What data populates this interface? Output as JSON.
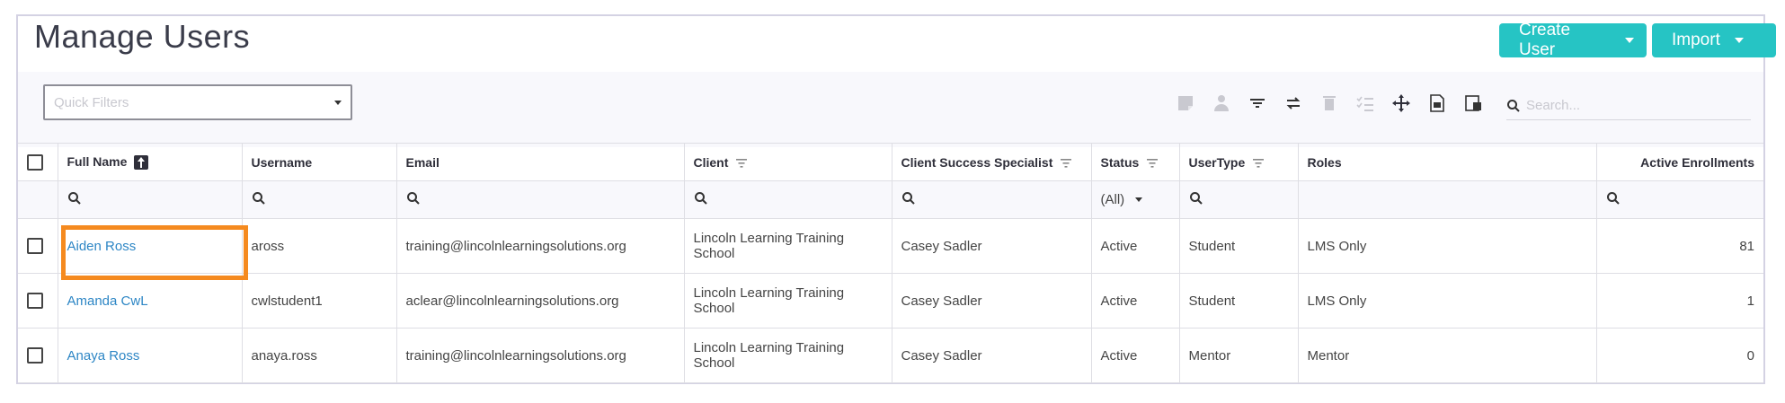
{
  "header": {
    "title": "Manage Users",
    "create_label": "Create User",
    "import_label": "Import"
  },
  "toolbar": {
    "quick_filter_placeholder": "Quick Filters",
    "search_placeholder": "Search...",
    "icons": [
      "sticky-note-icon",
      "user-badge-icon",
      "filter-icon",
      "swap-icon",
      "trash-icon",
      "checklist-icon",
      "move-icon",
      "pdf-export-icon",
      "column-chooser-icon",
      "search-icon"
    ]
  },
  "table": {
    "columns": [
      "Full Name",
      "Username",
      "Email",
      "Client",
      "Client Success Specialist",
      "Status",
      "UserType",
      "Roles",
      "Active Enrollments"
    ],
    "status_filter": "(All)",
    "rows": [
      {
        "full_name": "Aiden Ross",
        "username": "aross",
        "email": "training@lincolnlearningsolutions.org",
        "client": "Lincoln Learning Training School",
        "specialist": "Casey Sadler",
        "status": "Active",
        "usertype": "Student",
        "roles": "LMS Only",
        "enrollments": "81"
      },
      {
        "full_name": "Amanda CwL",
        "username": "cwlstudent1",
        "email": "aclear@lincolnlearningsolutions.org",
        "client": "Lincoln Learning Training School",
        "specialist": "Casey Sadler",
        "status": "Active",
        "usertype": "Student",
        "roles": "LMS Only",
        "enrollments": "1"
      },
      {
        "full_name": "Anaya Ross",
        "username": "anaya.ross",
        "email": "training@lincolnlearningsolutions.org",
        "client": "Lincoln Learning Training School",
        "specialist": "Casey Sadler",
        "status": "Active",
        "usertype": "Mentor",
        "roles": "Mentor",
        "enrollments": "0"
      }
    ]
  },
  "colors": {
    "accent": "#26c4c4",
    "link": "#2d86c5",
    "highlight": "#f58a1f"
  }
}
